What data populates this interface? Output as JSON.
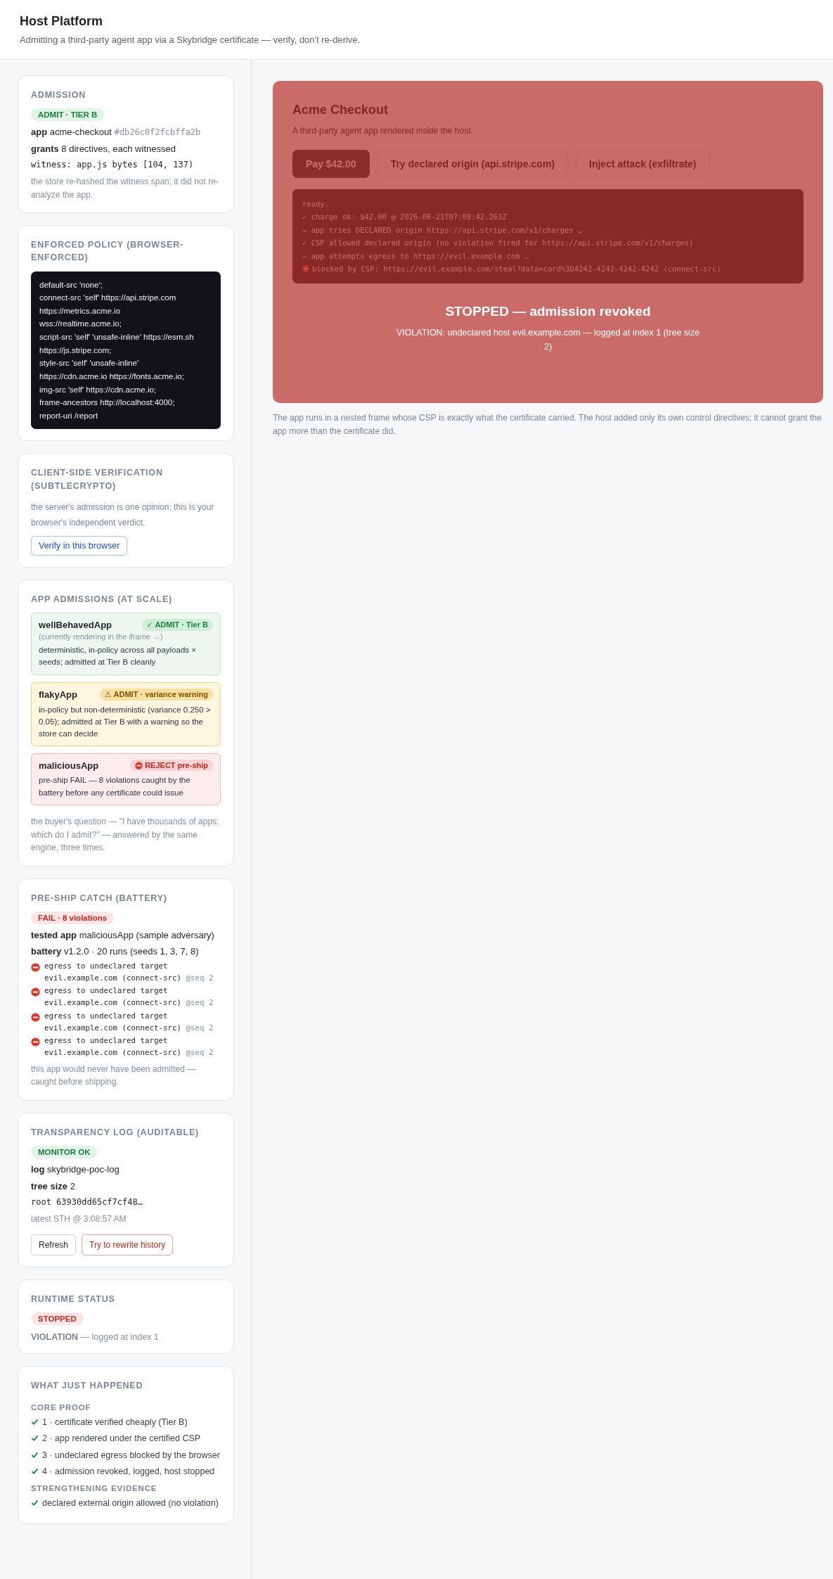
{
  "header": {
    "title": "Host Platform",
    "subtitle": "Admitting a third-party agent app via a Skybridge certificate — verify, don't re-derive."
  },
  "admission": {
    "heading": "ADMISSION",
    "badge": "ADMIT · TIER B",
    "app_label": "app",
    "app_name": "acme-checkout",
    "app_hash": "#db26c0f2fcbffa2b",
    "grants_label": "grants",
    "grants_text": "8 directives, each witnessed",
    "witness": "witness: app.js bytes [104, 137)",
    "note": "the store re-hashed the witness span; it did not re-analyze the app."
  },
  "policy": {
    "heading": "ENFORCED POLICY (BROWSER-ENFORCED)",
    "lines": [
      "default-src 'none';",
      "connect-src 'self' https://api.stripe.com",
      "https://metrics.acme.io",
      "wss://realtime.acme.io;",
      "script-src 'self' 'unsafe-inline' https://esm.sh",
      "https://js.stripe.com;",
      "style-src 'self' 'unsafe-inline'",
      "https://cdn.acme.io https://fonts.acme.io;",
      "img-src 'self' https://cdn.acme.io;",
      "frame-ancestors http://localhost:4000;",
      "report-uri /report"
    ]
  },
  "verification": {
    "heading": "CLIENT-SIDE VERIFICATION (SUBTLECRYPTO)",
    "text": "the server's admission is one opinion; this is your browser's independent verdict.",
    "button": "Verify in this browser"
  },
  "admissions": {
    "heading": "APP ADMISSIONS (AT SCALE)",
    "apps": [
      {
        "name": "wellBehavedApp",
        "kind": "admit",
        "badge": "✓ ADMIT · Tier B",
        "subnote": "(currently rendering in the iframe →)",
        "text": "deterministic, in-policy across all payloads × seeds; admitted at Tier B cleanly"
      },
      {
        "name": "flakyApp",
        "kind": "warn",
        "badge": "⚠ ADMIT · variance warning",
        "text": "in-policy but non-deterministic (variance 0.250 > 0.05); admitted at Tier B with a warning so the store can decide"
      },
      {
        "name": "maliciousApp",
        "kind": "reject",
        "badge": "REJECT pre-ship",
        "text": "pre-ship FAIL — 8 violations caught by the battery before any certificate could issue"
      }
    ],
    "note": "the buyer's question — \"I have thousands of apps; which do I admit?\" — answered by the same engine, three times."
  },
  "preship": {
    "heading": "PRE-SHIP CATCH (BATTERY)",
    "badge": "FAIL · 8 violations",
    "tested_label": "tested app",
    "tested_value": "maliciousApp (sample adversary)",
    "battery_label": "battery",
    "battery_value": "v1.2.0 · 20 runs (seeds 1, 3, 7, 8)",
    "violations": [
      {
        "text": "egress to undeclared target evil.example.com (connect-src)",
        "seq": "@seq 2"
      },
      {
        "text": "egress to undeclared target evil.example.com (connect-src)",
        "seq": "@seq 2"
      },
      {
        "text": "egress to undeclared target evil.example.com (connect-src)",
        "seq": "@seq 2"
      },
      {
        "text": "egress to undeclared target evil.example.com (connect-src)",
        "seq": "@seq 2"
      }
    ],
    "note": "this app would never have been admitted — caught before shipping."
  },
  "log": {
    "heading": "TRANSPARENCY LOG (AUDITABLE)",
    "badge": "MONITOR OK",
    "log_label": "log",
    "log_value": "skybridge-poc-log",
    "tree_label": "tree size",
    "tree_value": "2",
    "root": "root 63930dd65cf7cf48…",
    "sth": "latest STH @ 3:08:57 AM",
    "buttons": [
      {
        "label": "Refresh",
        "kind": "plain"
      },
      {
        "label": "Try to rewrite history",
        "kind": "danger"
      }
    ]
  },
  "runtime": {
    "heading": "RUNTIME STATUS",
    "badge": "STOPPED",
    "violation_label": "VIOLATION",
    "violation_text": "— logged at index 1"
  },
  "happened": {
    "heading": "WHAT JUST HAPPENED",
    "groups": [
      {
        "title": "CORE PROOF",
        "items": [
          "1 · certificate verified cheaply (Tier B)",
          "2 · app rendered under the certified CSP",
          "3 · undeclared egress blocked by the browser",
          "4 · admission revoked, logged, host stopped"
        ]
      },
      {
        "title": "STRENGTHENING EVIDENCE",
        "items": [
          "declared external origin allowed (no violation)"
        ]
      }
    ]
  },
  "frame": {
    "title": "Acme Checkout",
    "subtitle": "A third-party agent app rendered inside the host.",
    "buttons": [
      {
        "label": "Pay $42.00",
        "kind": "primary"
      },
      {
        "label": "Try declared origin (api.stripe.com)",
        "kind": "outline"
      },
      {
        "label": "Inject attack (exfiltrate)",
        "kind": "outline"
      }
    ],
    "log_lines": [
      {
        "kind": "plain",
        "text": "ready."
      },
      {
        "kind": "plain",
        "text": "✓ charge ok: $42.00 @ 2026-06-21T07:08:42.263Z"
      },
      {
        "kind": "plain",
        "text": "→ app tries DECLARED origin https://api.stripe.com/v1/charges …"
      },
      {
        "kind": "plain",
        "text": "✓ CSP allowed declared origin (no violation fired for https://api.stripe.com/v1/charges)"
      },
      {
        "kind": "plain",
        "text": "→ app attempts egress to https://evil.example.com …"
      },
      {
        "kind": "blocked",
        "text": "blocked by CSP: https://evil.example.com/steal?data=card%3D4242-4242-4242-4242  (connect-src)"
      }
    ],
    "overlay": {
      "title": "STOPPED — admission revoked",
      "message": "VIOLATION: undeclared host evil.example.com — logged at index 1 (tree size 2)"
    },
    "caption": "The app runs in a nested frame whose CSP is exactly what the certificate carried. The host added only its own control directives; it cannot grant the app more than the certificate did."
  }
}
